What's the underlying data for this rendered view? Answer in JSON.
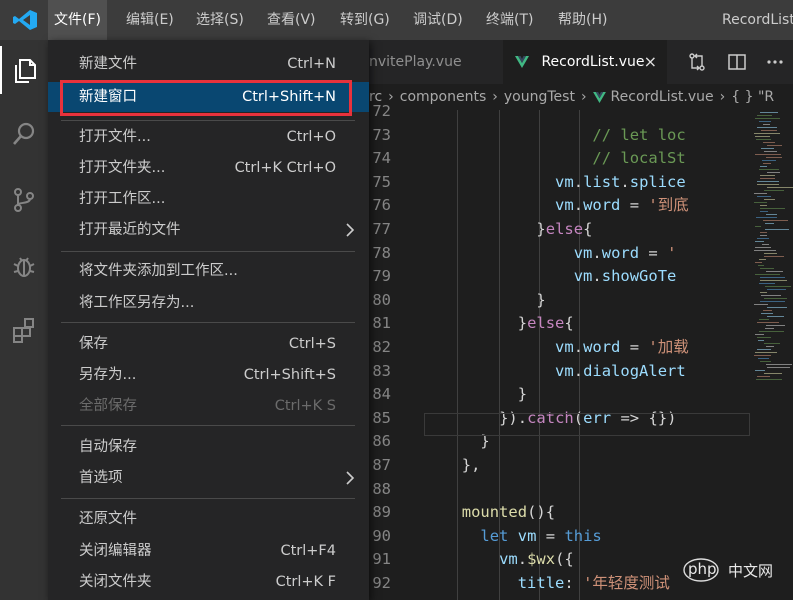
{
  "menubar": {
    "items": [
      "文件(F)",
      "编辑(E)",
      "选择(S)",
      "查看(V)",
      "转到(G)",
      "调试(D)",
      "终端(T)",
      "帮助(H)"
    ],
    "window_title": "RecordList."
  },
  "activity": {
    "icons": [
      "explorer-icon",
      "search-icon",
      "source-control-icon",
      "debug-icon",
      "extensions-icon"
    ]
  },
  "tabs": {
    "inactive": "nvitePlay.vue",
    "active": "RecordList.vue",
    "close": "×"
  },
  "breadcrumb": {
    "items": [
      "rc",
      "components",
      "youngTest",
      "RecordList.vue",
      "{ } \"R"
    ]
  },
  "file_menu": {
    "items": [
      {
        "label": "新建文件",
        "shortcut": "Ctrl+N"
      },
      {
        "label": "新建窗口",
        "shortcut": "Ctrl+Shift+N",
        "selected": true
      },
      {
        "label": "打开文件...",
        "shortcut": "Ctrl+O"
      },
      {
        "label": "打开文件夹...",
        "shortcut": "Ctrl+K Ctrl+O"
      },
      {
        "label": "打开工作区...",
        "shortcut": ""
      },
      {
        "label": "打开最近的文件",
        "shortcut": "",
        "submenu": true
      },
      {
        "label": "将文件夹添加到工作区...",
        "shortcut": ""
      },
      {
        "label": "将工作区另存为...",
        "shortcut": ""
      },
      {
        "label": "保存",
        "shortcut": "Ctrl+S"
      },
      {
        "label": "另存为...",
        "shortcut": "Ctrl+Shift+S"
      },
      {
        "label": "全部保存",
        "shortcut": "Ctrl+K S",
        "disabled": true
      },
      {
        "label": "自动保存",
        "shortcut": ""
      },
      {
        "label": "首选项",
        "shortcut": "",
        "submenu": true
      },
      {
        "label": "还原文件",
        "shortcut": ""
      },
      {
        "label": "关闭编辑器",
        "shortcut": "Ctrl+F4"
      },
      {
        "label": "关闭文件夹",
        "shortcut": "Ctrl+K F"
      }
    ],
    "submenu_arrow": "›"
  },
  "editor": {
    "lines": [
      {
        "n": "72",
        "t": ""
      },
      {
        "n": "73",
        "t": "                // let loc"
      },
      {
        "n": "74",
        "t": "                // localSt"
      },
      {
        "n": "75",
        "t": "            vm.list.splice"
      },
      {
        "n": "76",
        "t": "            vm.word = '到底"
      },
      {
        "n": "77",
        "t": "          }else{"
      },
      {
        "n": "78",
        "t": "              vm.word = '"
      },
      {
        "n": "79",
        "t": "              vm.showGoTe"
      },
      {
        "n": "80",
        "t": "          }"
      },
      {
        "n": "81",
        "t": "        }else{"
      },
      {
        "n": "82",
        "t": "            vm.word = '加载"
      },
      {
        "n": "83",
        "t": "            vm.dialogAlert"
      },
      {
        "n": "84",
        "t": "        }"
      },
      {
        "n": "85",
        "t": "      }).catch(err => {})"
      },
      {
        "n": "86",
        "t": "    }"
      },
      {
        "n": "87",
        "t": "  },"
      },
      {
        "n": "88",
        "t": ""
      },
      {
        "n": "89",
        "t": "  mounted(){"
      },
      {
        "n": "90",
        "t": "    let vm = this"
      },
      {
        "n": "91",
        "t": "      vm.$wx({"
      },
      {
        "n": "92",
        "t": "        title: '年轻度测试"
      }
    ]
  },
  "watermark": "php",
  "colors": {
    "menubar": "#3c3c3c",
    "menu_bg": "#252526",
    "menu_selected": "#094771",
    "highlight_box": "#e8323c",
    "vscode_blue": "#23a9f2",
    "vue_green": "#41b883"
  }
}
